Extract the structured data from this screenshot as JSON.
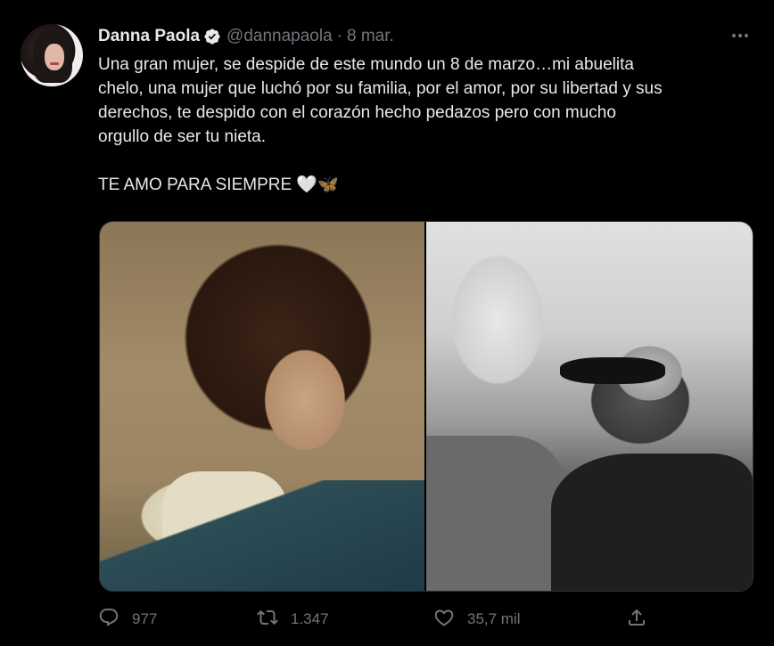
{
  "tweet": {
    "author_name": "Danna Paola",
    "handle": "@dannapaola",
    "separator": "·",
    "date": "8 mar.",
    "text": "Una gran mujer, se despide de este mundo un 8 de marzo…mi abuelita\nchelo, una mujer que luchó por su familia, por el amor, por su libertad y sus\nderechos, te despido con el corazón hecho pedazos pero con mucho\norgullo de ser tu nieta.\n\nTE AMO PARA SIEMPRE 🤍🦋",
    "media": [
      {
        "description_icon": "vintage-portrait-photo"
      },
      {
        "description_icon": "black-and-white-kiss-photo"
      }
    ]
  },
  "actions": {
    "reply_count": "977",
    "retweet_count": "1.347",
    "like_count": "35,7 mil"
  },
  "colors": {
    "background": "#000000",
    "primary_text": "#e7e9ea",
    "secondary_text": "#71767b",
    "verified": "#e7e9ea",
    "border": "#2f3336"
  },
  "icons": {
    "verified": "verified-badge-icon",
    "more": "more-options-icon",
    "reply": "reply-icon",
    "retweet": "retweet-icon",
    "like": "heart-icon",
    "share": "share-icon"
  }
}
